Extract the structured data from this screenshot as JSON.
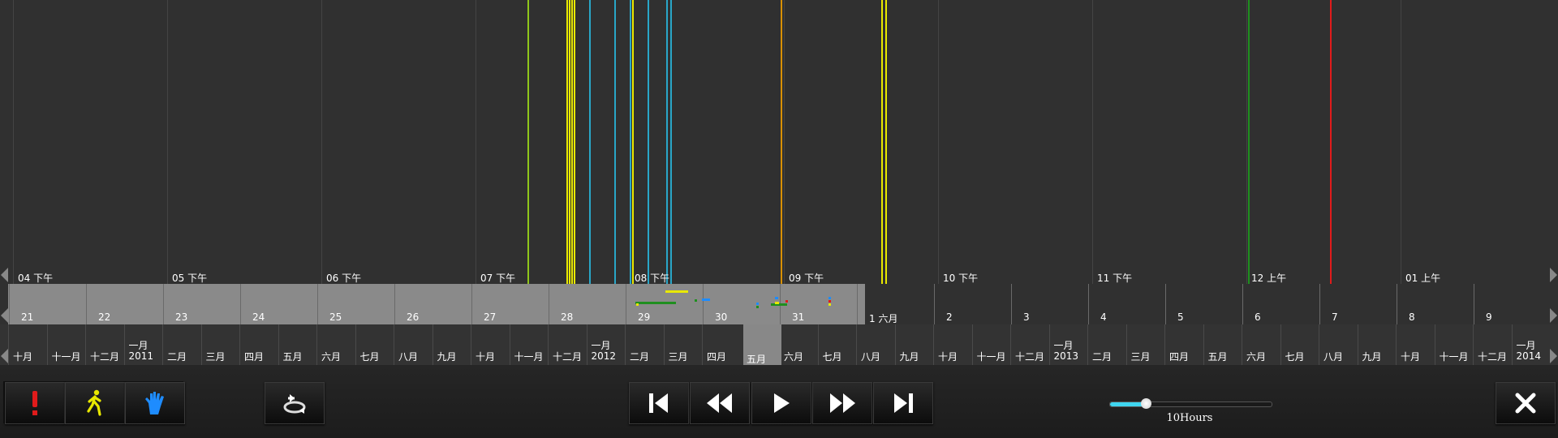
{
  "hour_labels": [
    "04 下午",
    "05 下午",
    "06 下午",
    "07 下午",
    "08 下午",
    "09 下午",
    "10 下午",
    "11 下午",
    "12 上午",
    "01 上午"
  ],
  "day_labels": [
    "21",
    "22",
    "23",
    "24",
    "25",
    "26",
    "27",
    "28",
    "29",
    "30",
    "31",
    "1 六月",
    "2",
    "3",
    "4",
    "5",
    "6",
    "7",
    "8",
    "9"
  ],
  "month_labels": [
    "十月",
    "十一月",
    "十二月",
    "一月\n2011",
    "二月",
    "三月",
    "四月",
    "五月",
    "六月",
    "七月",
    "八月",
    "九月",
    "十月",
    "十一月",
    "十二月",
    "一月\n2012",
    "二月",
    "三月",
    "四月",
    "五月",
    "六月",
    "七月",
    "八月",
    "九月",
    "十月",
    "十一月",
    "十二月",
    "一月\n2013",
    "二月",
    "三月",
    "四月",
    "五月",
    "六月",
    "七月",
    "八月",
    "九月",
    "十月",
    "十一月",
    "十二月",
    "一月\n2014"
  ],
  "selected_month": "五月",
  "event_colors": {
    "alarm": "#e01b1b",
    "motion": "#e8e800",
    "manual": "#1e8cff",
    "green": "#1f8f1f",
    "cyan": "#29a6c8",
    "orange": "#d89000",
    "lime": "#8fc61a"
  },
  "filters": [
    {
      "name": "alarm-filter",
      "icon": "exclamation-icon",
      "color": "#e01b1b"
    },
    {
      "name": "motion-filter",
      "icon": "walking-person-icon",
      "color": "#e8e800"
    },
    {
      "name": "manual-filter",
      "icon": "hand-icon",
      "color": "#1e8cff"
    }
  ],
  "playback_buttons": [
    {
      "name": "skip-to-start-button",
      "icon": "skip-start-icon"
    },
    {
      "name": "rewind-button",
      "icon": "rewind-icon"
    },
    {
      "name": "play-button",
      "icon": "play-icon"
    },
    {
      "name": "fast-forward-button",
      "icon": "fast-forward-icon"
    },
    {
      "name": "skip-to-end-button",
      "icon": "skip-end-icon"
    }
  ],
  "zoom": {
    "label": "10Hours",
    "level": 0.22
  }
}
